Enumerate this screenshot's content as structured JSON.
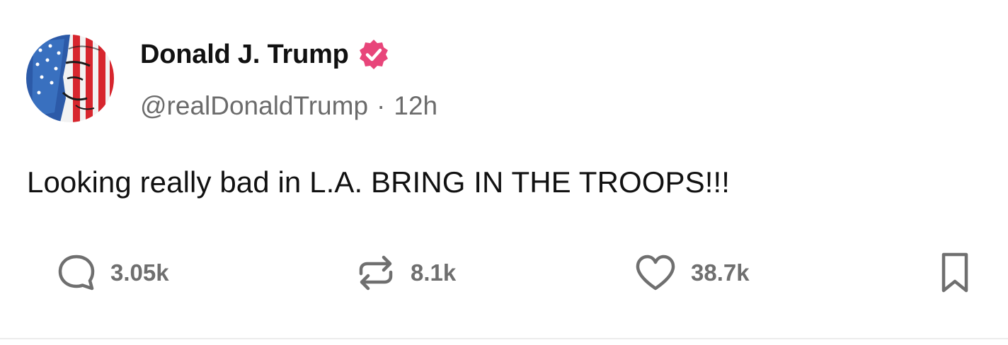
{
  "post": {
    "author": {
      "display_name": "Donald J. Trump",
      "handle": "@realDonaldTrump",
      "verified": true,
      "verified_color": "#e8457a",
      "avatar_icon": "flag-portrait-avatar"
    },
    "separator": "·",
    "timestamp": "12h",
    "text": "Looking really bad in L.A. BRING IN THE TROOPS!!!",
    "actions": {
      "replies": {
        "icon": "reply-icon",
        "count": "3.05k"
      },
      "retruths": {
        "icon": "retruth-icon",
        "count": "8.1k"
      },
      "likes": {
        "icon": "heart-icon",
        "count": "38.7k"
      },
      "bookmark": {
        "icon": "bookmark-icon"
      }
    },
    "colors": {
      "text": "#111111",
      "muted": "#6b6b6b",
      "divider": "#ececec"
    }
  }
}
